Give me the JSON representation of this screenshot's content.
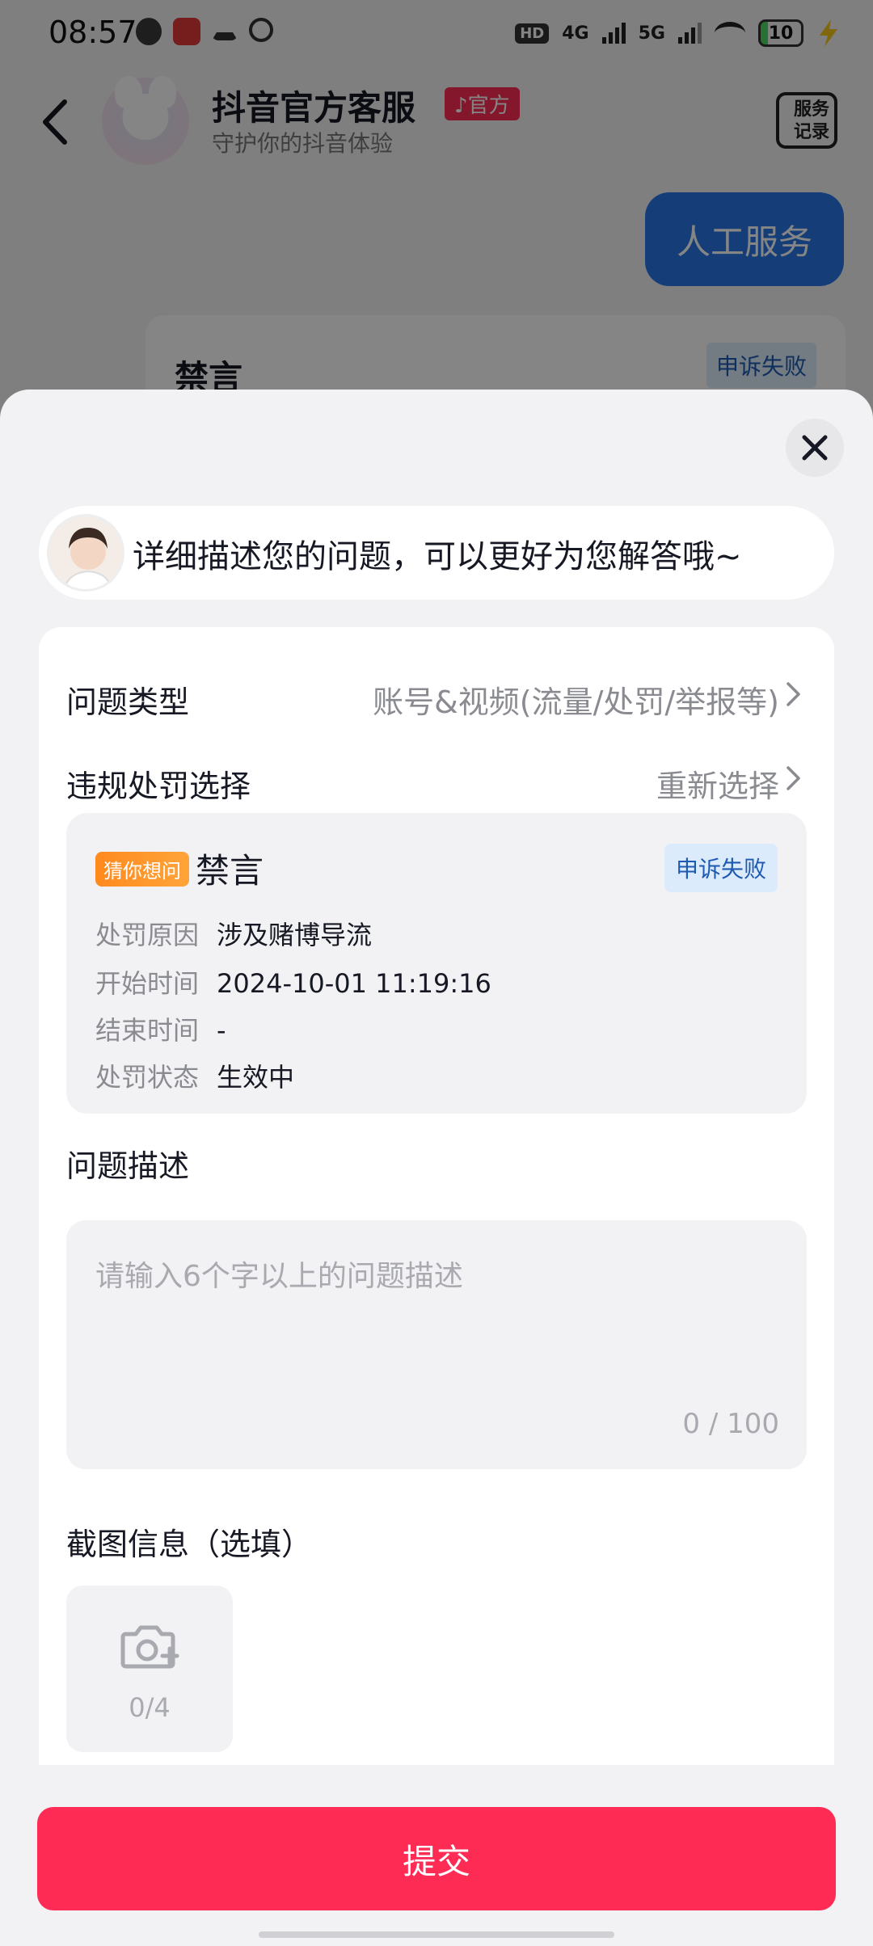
{
  "status_bar": {
    "time": "08:57",
    "network_hd": "HD",
    "network_4g": "4G",
    "network_5g": "5G",
    "battery": "10"
  },
  "chat": {
    "title": "抖音官方客服",
    "official_badge": "♪官方",
    "subtitle": "守护你的抖音体验",
    "service_record_label": "服务记录",
    "human_service_label": "人工服务",
    "card_title": "禁言",
    "card_badge": "申诉失败"
  },
  "sheet": {
    "prompt": "详细描述您的问题，可以更好为您解答哦~",
    "problem_type": {
      "label": "问题类型",
      "value": "账号&视频(流量/处罚/举报等)"
    },
    "violation": {
      "label": "违规处罚选择",
      "action": "重新选择"
    },
    "penalty": {
      "tag": "猜你想问",
      "title": "禁言",
      "status_badge": "申诉失败",
      "details": [
        {
          "key": "处罚原因",
          "value": "涉及赌博导流"
        },
        {
          "key": "开始时间",
          "value": "2024-10-01 11:19:16"
        },
        {
          "key": "结束时间",
          "value": "-"
        },
        {
          "key": "处罚状态",
          "value": "生效中"
        }
      ]
    },
    "description": {
      "label": "问题描述",
      "placeholder": "请输入6个字以上的问题描述",
      "value": "",
      "counter": "0 / 100"
    },
    "screenshots": {
      "label": "截图信息（选填）",
      "count": "0/4"
    },
    "submit_label": "提交"
  },
  "colors": {
    "accent": "#fe2c55",
    "blue_button": "#2a78e8",
    "badge_bg": "#dcebfb",
    "badge_text": "#1e5bb0",
    "tag_orange": "#ff8a1e"
  }
}
